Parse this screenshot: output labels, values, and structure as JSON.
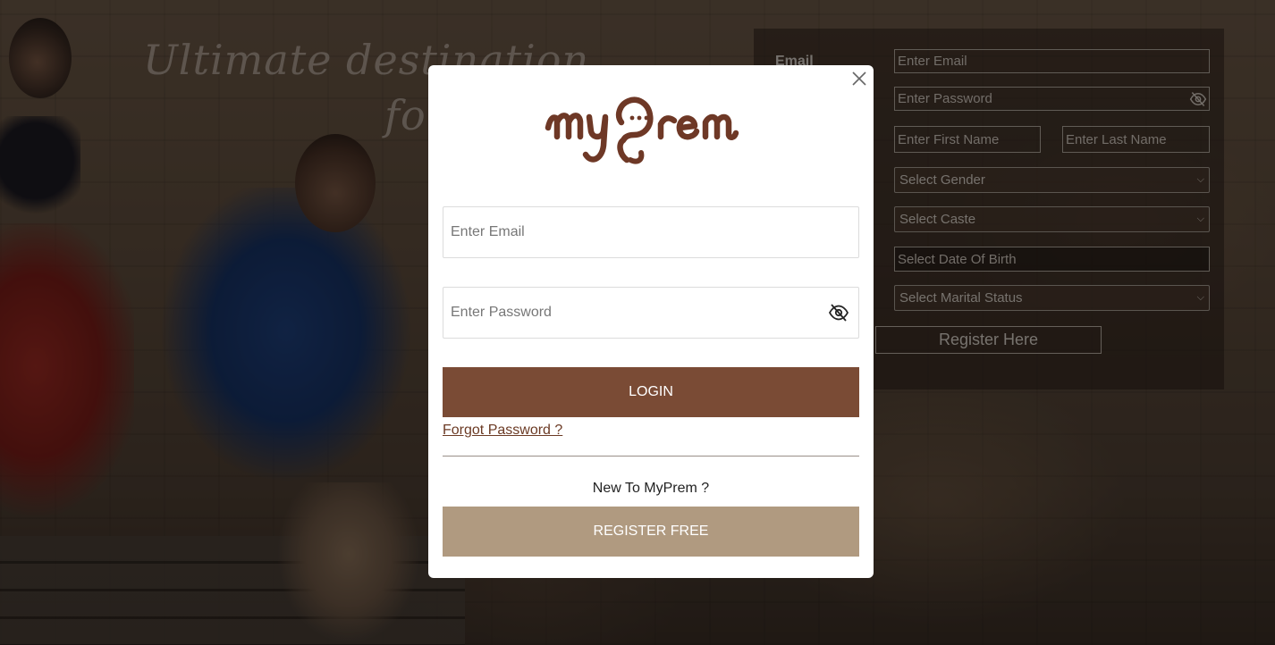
{
  "background": {
    "tagline_line1": "Ultimate destination",
    "tagline_line2": "fo"
  },
  "registration": {
    "email_label": "Email",
    "email_placeholder": "Enter Email",
    "password_placeholder": "Enter Password",
    "first_name_placeholder": "Enter First Name",
    "last_name_placeholder": "Enter Last Name",
    "gender_select": "Select Gender",
    "caste_select": "Select Caste",
    "dob_placeholder": "Select Date Of Birth",
    "marital_select": "Select Marital Status",
    "register_button": "Register Here"
  },
  "modal": {
    "logo_text": "myPrem",
    "email_placeholder": "Enter Email",
    "password_placeholder": "Enter Password",
    "login_button": "LOGIN",
    "forgot_link": "Forgot Password ?",
    "new_to_text": "New To MyPrem ?",
    "register_button": "REGISTER FREE",
    "icons": {
      "close": "close-icon",
      "password_toggle": "eye-slash-icon"
    }
  },
  "colors": {
    "brand_brown": "#7a4b35",
    "register_tan": "#b09a80",
    "logo_brown": "#6e3826"
  }
}
